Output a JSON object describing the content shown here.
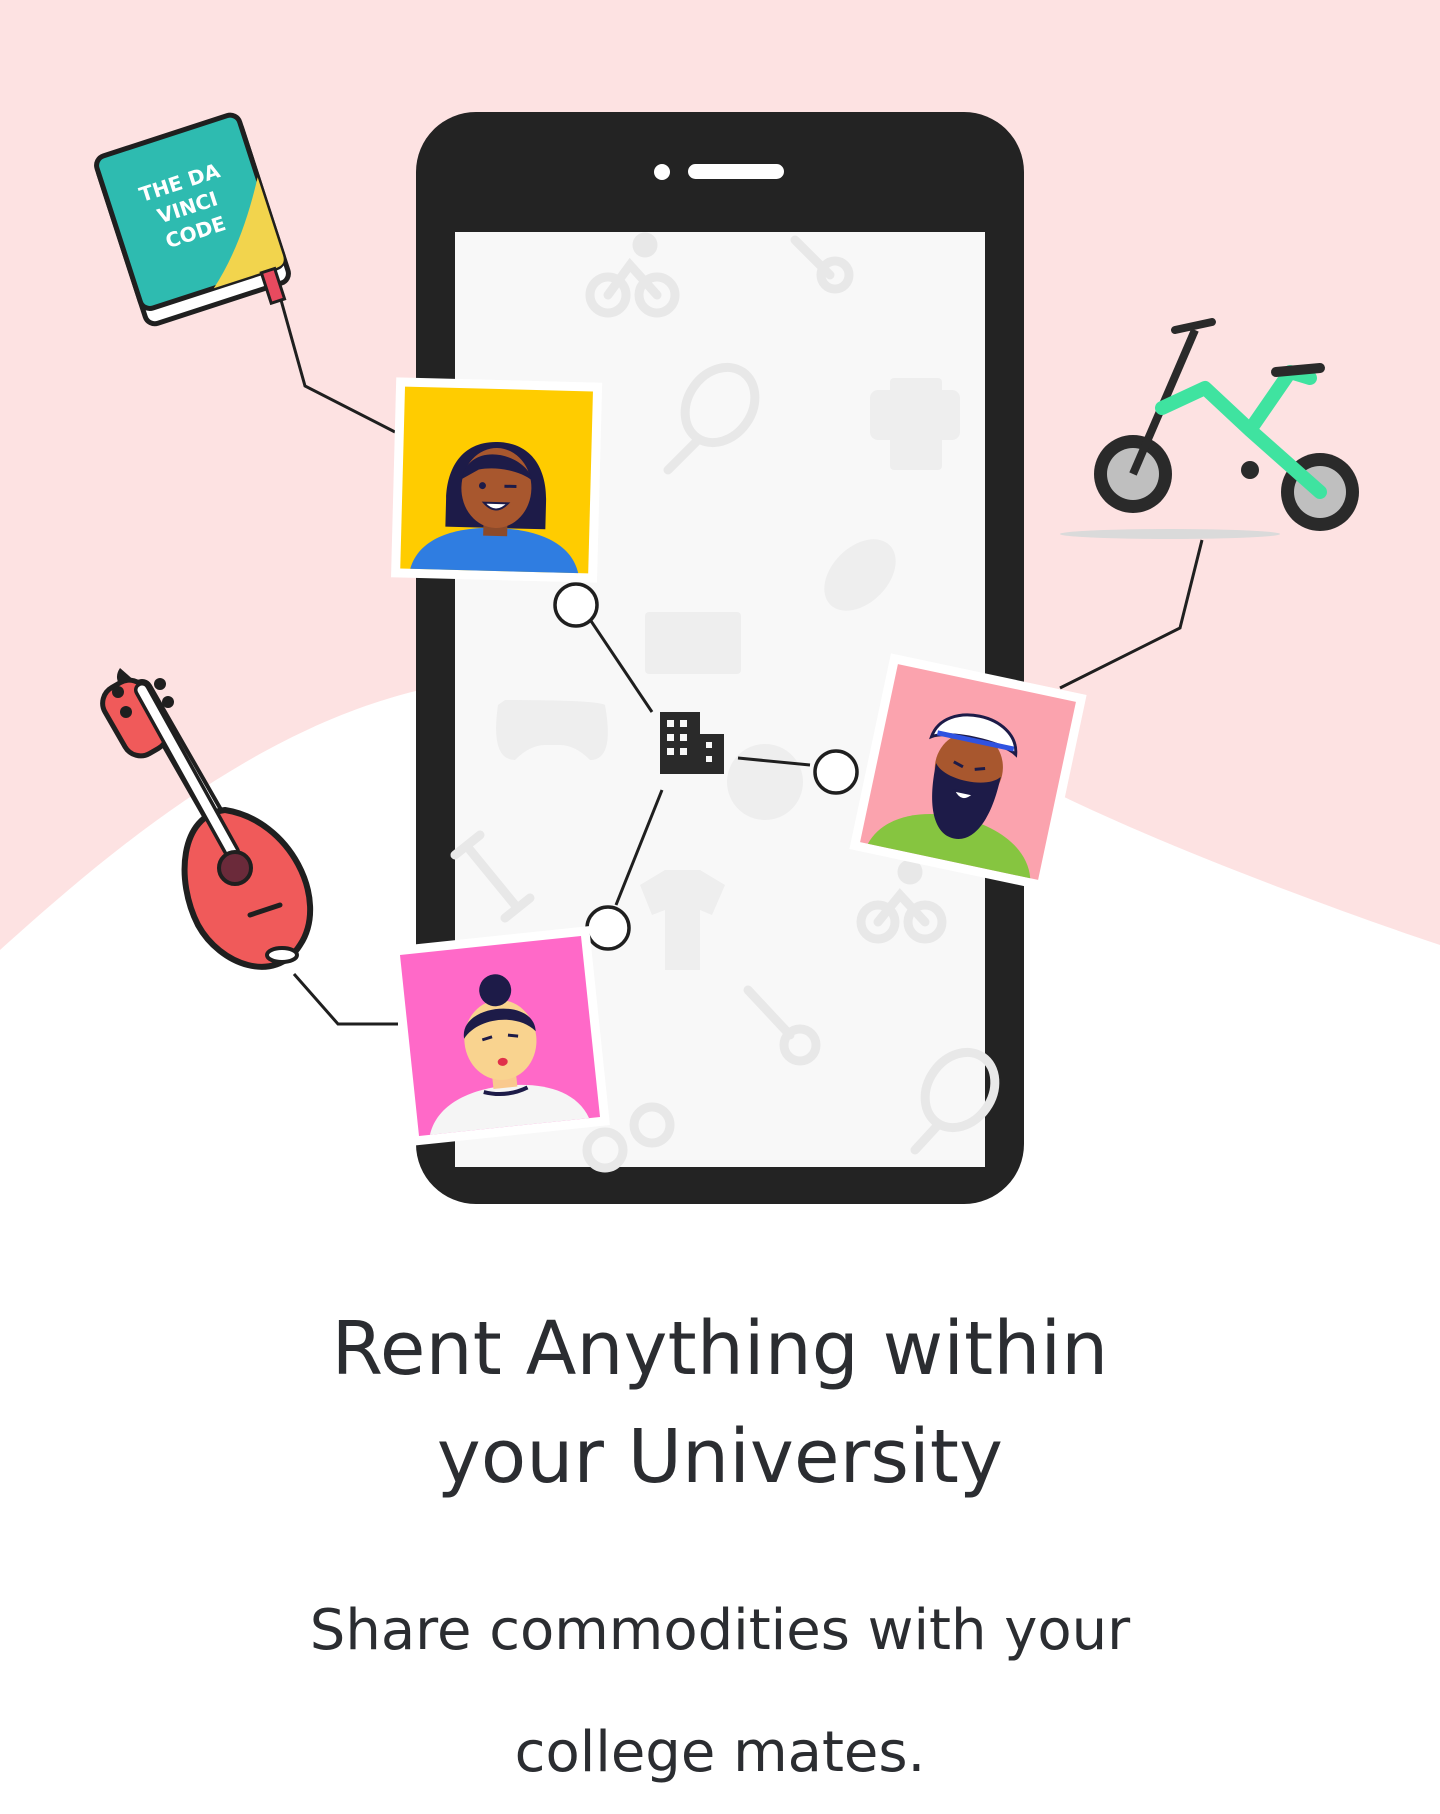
{
  "hero": {
    "book_title_lines": [
      "THE DA",
      "VINCI",
      "CODE"
    ],
    "colors": {
      "top_background": "#fde2e2",
      "bottom_background": "#ffffff",
      "phone_frame": "#232323",
      "phone_screen": "#f8f8f8",
      "watermark_icons": "#ececec",
      "connector_line": "#1f1f1f",
      "avatar_1_bg": "#ffcc00",
      "avatar_2_bg": "#fba3ae",
      "avatar_3_bg": "#ff69c8",
      "bike_accent": "#3fe3a0",
      "book_cover": "#2ebbb0",
      "mandolin_body": "#f05a5a"
    },
    "icons": [
      "phone-icon",
      "book-icon",
      "bicycle-icon",
      "mandolin-icon",
      "building-icon",
      "person-avatar-icon"
    ]
  },
  "headline": {
    "line1": "Rent Anything within",
    "line2": "your University"
  },
  "subline": {
    "line1": "Share commodities with your",
    "line2": "college mates."
  }
}
